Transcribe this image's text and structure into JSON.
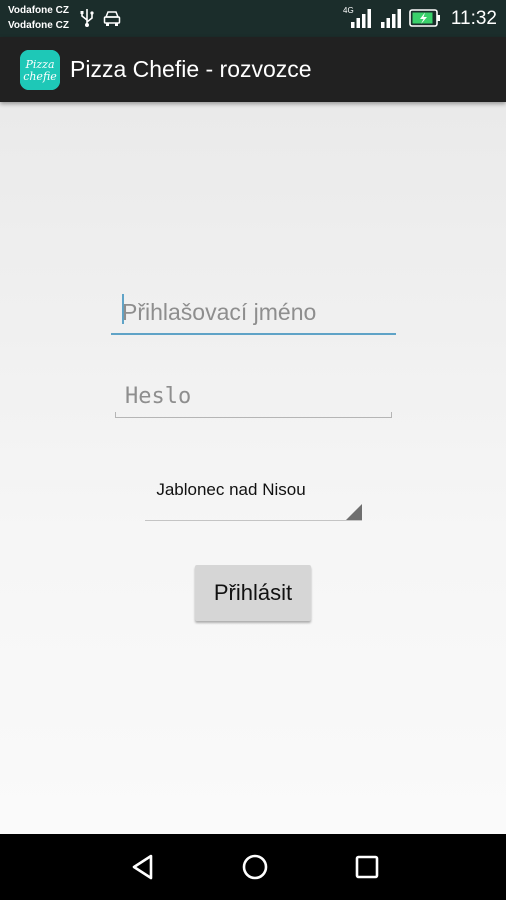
{
  "status_bar": {
    "carriers": [
      "Vodafone CZ",
      "Vodafone CZ"
    ],
    "network_type": "4G",
    "time": "11:32",
    "icons": [
      "usb-icon",
      "car-mode-icon",
      "signal-icon",
      "signal-icon",
      "battery-charging-icon"
    ]
  },
  "app_bar": {
    "logo_text": [
      "Pizza",
      "chefie"
    ],
    "title": "Pizza Chefie - rozvozce"
  },
  "login_form": {
    "username_placeholder": "Přihlašovací jméno",
    "password_placeholder": "Heslo",
    "city_selected": "Jablonec nad Nisou",
    "submit_label": "Přihlásit"
  },
  "nav_bar": {
    "icons": [
      "back-icon",
      "home-icon",
      "recent-apps-icon"
    ]
  },
  "colors": {
    "status_bar": "#1b2d2b",
    "app_bar": "#212121",
    "logo": "#1ec8b7",
    "focus_accent": "#5fa3c7",
    "button": "#d6d6d6"
  }
}
